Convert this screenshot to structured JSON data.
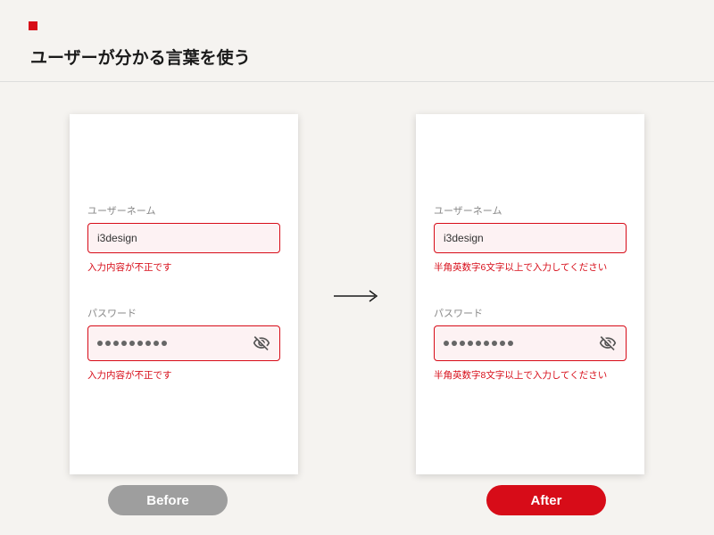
{
  "header": {
    "title": "ユーザーが分かる言葉を使う"
  },
  "before": {
    "username_label": "ユーザーネーム",
    "username_value": "i3design",
    "username_error": "入力内容が不正です",
    "password_label": "パスワード",
    "password_error": "入力内容が不正です",
    "badge": "Before"
  },
  "after": {
    "username_label": "ユーザーネーム",
    "username_value": "i3design",
    "username_error": "半角英数字6文字以上で入力してください",
    "password_label": "パスワード",
    "password_error": "半角英数字8文字以上で入力してください",
    "badge": "After"
  },
  "arrow": "—→"
}
